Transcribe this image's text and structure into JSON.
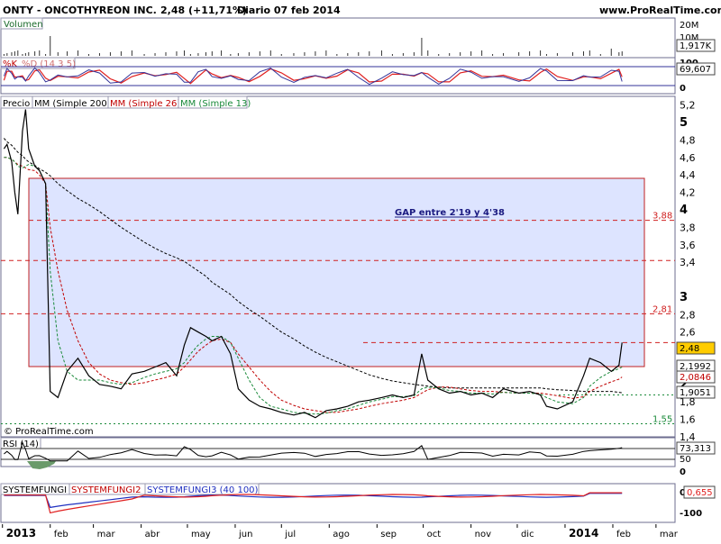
{
  "header": {
    "title": "ONTY - ONCOTHYREON INC.",
    "price_change": "2,48 (+11,71%)",
    "period_date": "Diario  07 feb 2014",
    "site": "www.ProRealTime.com"
  },
  "volume_panel": {
    "label": "Volumen",
    "ticks": [
      "20M",
      "10M"
    ],
    "current_badge": "1,917K"
  },
  "stoch_panel": {
    "k_label": "%K",
    "d_label": "%D (14 3 5)",
    "ticks": [
      "100",
      "0"
    ],
    "current_badge": "69,607"
  },
  "price_panel": {
    "tabs": [
      "Precio",
      "MM (Simple 200)",
      "MM (Simple 26)",
      "MM (Simple 13)"
    ],
    "ticks": [
      "5,2",
      "5",
      "4,8",
      "4,6",
      "4,4",
      "4,2",
      "4",
      "3,8",
      "3,6",
      "3,4",
      "3",
      "2,8",
      "2,6",
      "2,4",
      "2,2",
      "2",
      "1,8",
      "1,6",
      "1,4"
    ],
    "gap_label": "GAP entre 2'19 y 4'38",
    "level_labels": [
      "3,88",
      "2,81",
      "1,55"
    ],
    "badges": [
      "2,48",
      "2,1992",
      "2,0846",
      "1,9051"
    ],
    "copyright": "© ProRealTime.com"
  },
  "rsi_panel": {
    "label": "RSI (14)",
    "ticks": [
      "50",
      "0"
    ],
    "current_badge": "73,313"
  },
  "fungi_panel": {
    "labels": [
      "SYSTEMFUNGI",
      "SYSTEMFUNGI2",
      "SYSTEMFUNGI3 (40 100)"
    ],
    "ticks": [
      "0",
      "-100"
    ],
    "current_badge": "0,655"
  },
  "x_axis": {
    "labels": [
      "2013",
      "feb",
      "mar",
      "abr",
      "may",
      "jun",
      "jul",
      "ago",
      "sep",
      "oct",
      "nov",
      "dic",
      "2014",
      "feb",
      "mar"
    ]
  },
  "colors": {
    "background": "#ffffff",
    "panel_border": "#6d6d8f",
    "price": "#000000",
    "sma200": "#000000",
    "sma26": "#c00000",
    "sma13": "#1a8a3a",
    "gap_fill": "#dde4ff",
    "gap_border": "#c02020",
    "level_line": "#d02020",
    "stoch_k": "#333399",
    "stoch_d": "#e02020",
    "price_badge": "#ffcc00",
    "fungi2": "#e02020",
    "fungi3": "#2030c0"
  },
  "chart_data": {
    "type": "line",
    "title": "ONTY - ONCOTHYREON INC.",
    "x": [
      "2013-01-02",
      "2013-01-04",
      "2013-01-07",
      "2013-01-09",
      "2013-01-11",
      "2013-01-14",
      "2013-01-16",
      "2013-01-18",
      "2013-01-22",
      "2013-01-25",
      "2013-01-29",
      "2013-02-01",
      "2013-02-06",
      "2013-02-12",
      "2013-02-19",
      "2013-02-26",
      "2013-03-05",
      "2013-03-12",
      "2013-03-19",
      "2013-03-26",
      "2013-04-03",
      "2013-04-10",
      "2013-04-17",
      "2013-04-24",
      "2013-04-29",
      "2013-05-03",
      "2013-05-08",
      "2013-05-13",
      "2013-05-17",
      "2013-05-23",
      "2013-05-29",
      "2013-06-03",
      "2013-06-10",
      "2013-06-17",
      "2013-06-24",
      "2013-07-01",
      "2013-07-09",
      "2013-07-16",
      "2013-07-23",
      "2013-07-30",
      "2013-08-06",
      "2013-08-13",
      "2013-08-20",
      "2013-08-27",
      "2013-09-04",
      "2013-09-11",
      "2013-09-18",
      "2013-09-25",
      "2013-09-30",
      "2013-10-04",
      "2013-10-11",
      "2013-10-18",
      "2013-10-25",
      "2013-11-01",
      "2013-11-08",
      "2013-11-15",
      "2013-11-22",
      "2013-12-02",
      "2013-12-09",
      "2013-12-16",
      "2013-12-20",
      "2013-12-27",
      "2014-01-06",
      "2014-01-13",
      "2014-01-17",
      "2014-01-24",
      "2014-01-31",
      "2014-02-05",
      "2014-02-07"
    ],
    "series": [
      {
        "name": "Precio",
        "values": [
          4.7,
          4.75,
          4.55,
          4.2,
          3.95,
          4.9,
          5.15,
          4.7,
          4.5,
          4.45,
          4.3,
          1.92,
          1.85,
          2.15,
          2.3,
          2.1,
          2.0,
          1.98,
          1.95,
          2.12,
          2.15,
          2.2,
          2.25,
          2.1,
          2.45,
          2.65,
          2.6,
          2.55,
          2.5,
          2.55,
          2.35,
          1.95,
          1.82,
          1.75,
          1.72,
          1.68,
          1.65,
          1.68,
          1.62,
          1.7,
          1.72,
          1.75,
          1.8,
          1.82,
          1.85,
          1.88,
          1.85,
          1.88,
          2.35,
          2.05,
          1.95,
          1.9,
          1.92,
          1.88,
          1.9,
          1.85,
          1.95,
          1.9,
          1.92,
          1.88,
          1.75,
          1.72,
          1.8,
          2.1,
          2.3,
          2.25,
          2.15,
          2.22,
          2.48
        ]
      },
      {
        "name": "MM (Simple 200)",
        "values": [
          4.82,
          4.78,
          4.74,
          4.7,
          4.66,
          4.62,
          4.58,
          4.55,
          4.51,
          4.47,
          4.43,
          4.39,
          4.3,
          4.22,
          4.13,
          4.06,
          3.98,
          3.89,
          3.8,
          3.72,
          3.63,
          3.56,
          3.5,
          3.45,
          3.41,
          3.36,
          3.3,
          3.24,
          3.17,
          3.1,
          3.03,
          2.95,
          2.86,
          2.78,
          2.69,
          2.6,
          2.52,
          2.44,
          2.37,
          2.31,
          2.26,
          2.21,
          2.16,
          2.11,
          2.07,
          2.04,
          2.02,
          2.0,
          1.99,
          1.98,
          1.97,
          1.96,
          1.96,
          1.96,
          1.96,
          1.96,
          1.96,
          1.96,
          1.96,
          1.96,
          1.95,
          1.94,
          1.93,
          1.92,
          1.92,
          1.92,
          1.92,
          1.91,
          1.905
        ]
      },
      {
        "name": "MM (Simple 26)",
        "values": [
          4.6,
          4.6,
          4.58,
          4.55,
          4.52,
          4.5,
          4.48,
          4.46,
          4.45,
          4.4,
          4.3,
          3.8,
          3.3,
          2.85,
          2.5,
          2.25,
          2.12,
          2.05,
          2.02,
          2.0,
          2.02,
          2.05,
          2.08,
          2.12,
          2.2,
          2.28,
          2.38,
          2.45,
          2.5,
          2.52,
          2.48,
          2.35,
          2.2,
          2.05,
          1.92,
          1.82,
          1.76,
          1.72,
          1.7,
          1.68,
          1.68,
          1.7,
          1.72,
          1.75,
          1.78,
          1.8,
          1.82,
          1.85,
          1.9,
          1.94,
          1.97,
          1.97,
          1.95,
          1.93,
          1.92,
          1.92,
          1.91,
          1.9,
          1.9,
          1.9,
          1.89,
          1.87,
          1.84,
          1.86,
          1.92,
          1.98,
          2.03,
          2.06,
          2.0846
        ]
      },
      {
        "name": "MM (Simple 13)",
        "values": [
          4.6,
          4.6,
          4.58,
          4.55,
          4.5,
          4.48,
          4.5,
          4.52,
          4.5,
          4.45,
          4.3,
          3.3,
          2.5,
          2.15,
          2.05,
          2.05,
          2.05,
          2.02,
          2.0,
          2.02,
          2.08,
          2.12,
          2.15,
          2.18,
          2.25,
          2.35,
          2.45,
          2.52,
          2.55,
          2.55,
          2.48,
          2.3,
          2.05,
          1.85,
          1.75,
          1.72,
          1.68,
          1.67,
          1.66,
          1.67,
          1.7,
          1.72,
          1.76,
          1.8,
          1.83,
          1.86,
          1.86,
          1.87,
          1.95,
          1.97,
          1.96,
          1.93,
          1.92,
          1.9,
          1.9,
          1.89,
          1.91,
          1.9,
          1.9,
          1.89,
          1.85,
          1.8,
          1.78,
          1.85,
          1.98,
          2.08,
          2.15,
          2.18,
          2.1992
        ]
      }
    ],
    "ylim": [
      1.4,
      5.3
    ],
    "gap_zone": [
      2.19,
      4.38
    ],
    "levels": [
      3.88,
      3.42,
      2.81,
      2.48,
      1.88,
      1.55
    ],
    "xlabel": "",
    "ylabel": "",
    "grid": false
  }
}
